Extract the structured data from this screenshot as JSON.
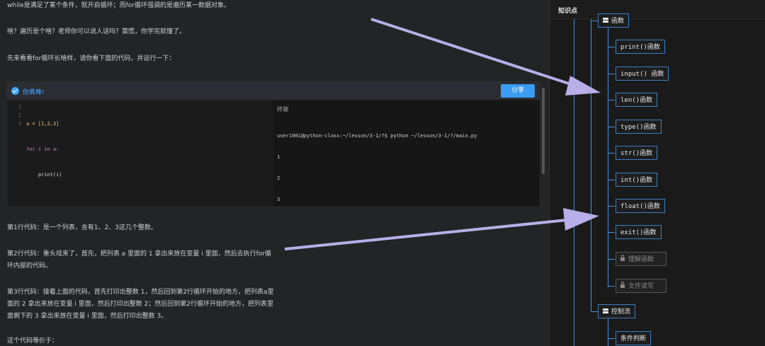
{
  "content": {
    "paragraphs": [
      "while是满足了某个条件，就开启循环；而for循环强调的是遍历某一数据对象。",
      "啥？遍历是个啥？老师你可以说人话吗？莫慌，你学完就懂了。",
      "先来看看for循环长啥样，请你看下面的代码，并运行一下：",
      "第1行代码：是一个列表，含有1、2、3这几个整数。",
      "第2行代码：重头戏来了，首先，把列表 a 里面的 1 拿出来放在变量 i 里面，然后去执行for循环内部的代码。",
      "第3行代码：接着上面的代码，首先打印出整数 1，然后回到第2行循环开始的地方，把列表a里面的 2 拿出来放在变量 i 里面，然后打印出整数 2；然后回到第2行循环开始的地方，把列表里面剩下的 3 拿出来放在变量 i 里面，然后打印出整数 3。",
      "这个代码等价于："
    ]
  },
  "editor": {
    "status": "你真棒!",
    "share_label": "分享",
    "line_numbers": [
      "1",
      "2",
      "3"
    ],
    "code_lines": [
      "a = [1,2,3]",
      "for i in a:",
      "    print(i)"
    ],
    "terminal_title": "终端",
    "terminal_lines": [
      "user1001@python-class:~/lesson/3-1/?$ python ~/lesson/3-1/?/main.py",
      "1",
      "2",
      "3"
    ]
  },
  "sidebar": {
    "title": "知识点",
    "groups": [
      {
        "label": "函数"
      },
      {
        "label": "控制流"
      }
    ],
    "items": [
      {
        "label": "print()函数",
        "locked": false
      },
      {
        "label": "input() 函数",
        "locked": false
      },
      {
        "label": "len()函数",
        "locked": false
      },
      {
        "label": "type()函数",
        "locked": false
      },
      {
        "label": "str()函数",
        "locked": false
      },
      {
        "label": "int()函数",
        "locked": false
      },
      {
        "label": "float()函数",
        "locked": false
      },
      {
        "label": "exit()函数",
        "locked": false
      },
      {
        "label": "理解函数",
        "locked": true
      },
      {
        "label": "文件读写",
        "locked": true
      },
      {
        "label": "条件判断",
        "locked": false
      }
    ]
  },
  "colors": {
    "accent": "#3a9cf2",
    "tree_line": "#4a90d9",
    "annotation_arrow": "#b8aee8"
  }
}
